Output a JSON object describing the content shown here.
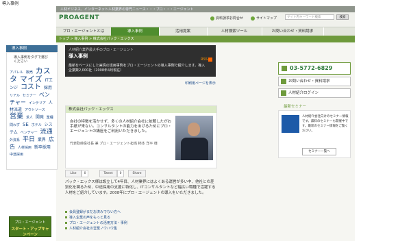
{
  "browser": {
    "tab_title": "導入事例"
  },
  "header": {
    "tagline": "人材ビジネス、インターネット人材業界の専門ニュース・・・ブロ・・・エージェント",
    "logo": "PROAGENT",
    "link_contact": "資料請求お問合せ",
    "link_sitemap": "サイトマップ",
    "search_placeholder": "サイト内キーワード検索",
    "search_button": "検索"
  },
  "nav": {
    "items": [
      {
        "label": "プロ・エージェントとは",
        "active": false
      },
      {
        "label": "導入事例",
        "active": true
      },
      {
        "label": "活用提案",
        "active": false
      },
      {
        "label": "人材検索ツール",
        "active": false
      },
      {
        "label": "お問い合わせ・資料請求",
        "active": false
      }
    ]
  },
  "breadcrumb": "トップ > 導入事例 > 株式会社パック・エックス",
  "sidebar": {
    "header": "導入事例",
    "note": "導入事例をタグで選びください",
    "tags": [
      "アパレル",
      "販売",
      "カスタ",
      "マイズ",
      "ITエンジ",
      "コスト",
      "採用",
      "リアル",
      "セミナー",
      "ベンチャー",
      "インテリア",
      "人材派遣",
      "アウトソース",
      "営業",
      "求人",
      "開発",
      "業種問わず",
      "SE",
      "ホテル",
      "システム",
      "ベンチャー",
      "流通",
      "外資系",
      "平日",
      "業界",
      "広告",
      "人材採用",
      "新卒採用",
      "中途採用"
    ],
    "banner_top": "プロ・エージェント",
    "banner_bottom": "スタート・アップキャンペーン"
  },
  "hero": {
    "subtitle": "人材紹介業界最大手のプロ・エージェント",
    "title": "導入事例",
    "rss": "RSS",
    "text": "最新をベースにした実情の活用事例をプロ・エージェントの導入事例で紹介します。導入企業数2,000社（2008年4月現在）"
  },
  "print_link": "印刷用ページを表示",
  "article": {
    "company": "株式会社パック・エックス",
    "lead": "自社の特徴を活かせず、多くの人材紹介会社に依頼したがお手紙が来ない。コンサルタントの能力をあげるためにプロ・エージェントの講座をご利用いただきました。",
    "info": "代表取締役社長 兼 プロ・エージェント担当 柿本 洋平 様"
  },
  "social": {
    "like": "Like",
    "tweet": "Tweet",
    "share": "Share",
    "count": "0"
  },
  "description": "パック・エックス様は設立して4年目、人材業界にはよくある運営が多い中、他社との差別化を図るため、中途採用の支援に特化し、ITコンサルタントなど幅広い職種で活躍する人材をご紹介しています。2008年にプロ・エージェントの導入をいただきました。",
  "related_links": [
    "会員登録がまだお済みでない方へ",
    "導入企業の声をもっと見る",
    "プロ・エージェントの活用方法・事例",
    "人材紹介会社の営業ノウハウ集"
  ],
  "right": {
    "phone": "03-5772-6829",
    "btn_contact": "お問い合わせ・資料請求",
    "btn_login": "人材紹介ログイン",
    "seminar_title": "最新セミナー",
    "seminar_text": "人材紹介会社向けのセミナー情報です。無料のセミナーも開催中です。最新のセミナー情報をご覧ください。",
    "seminar_button": "セミナー一覧へ"
  }
}
